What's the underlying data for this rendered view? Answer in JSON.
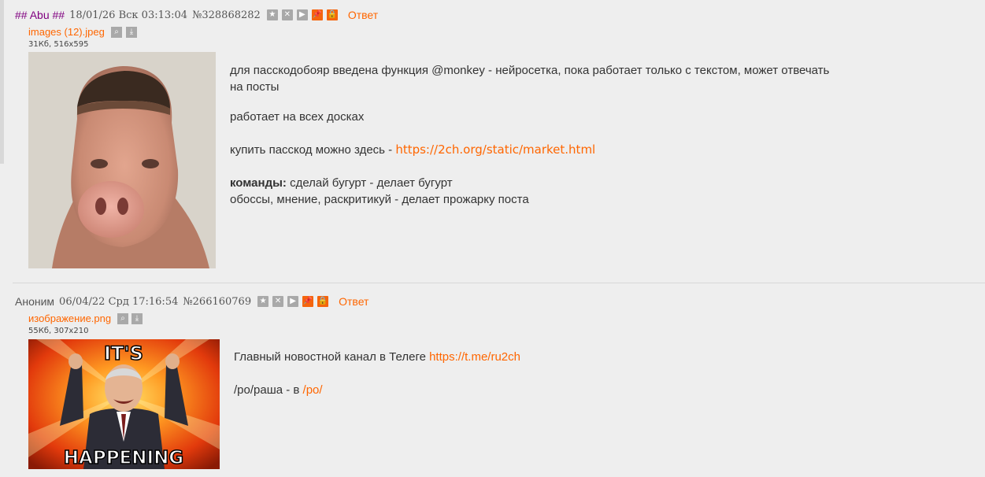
{
  "post1": {
    "name": "## Abu ##",
    "date": "18/01/26 Вск 03:13:04",
    "number": "№328868282",
    "reply": "Ответ",
    "file": {
      "name": "images (12).jpeg",
      "info": "31Кб, 516x595"
    },
    "message": {
      "line1": "для пасскодобояр введена функция @monkey - нейросетка, пока работает только с текстом, может отвечать",
      "line1b": "на посты",
      "line2": "работает на всех досках",
      "line3_text": "купить пасскод можно здесь - ",
      "line3_link": "https://2ch.org/static/market.html",
      "line4_bold": "команды:",
      "line4_text": " сделай бугурт - делает бугурт",
      "line5": "обоссы, мнение, раскритикуй - делает прожарку поста"
    }
  },
  "post2": {
    "name": "Аноним",
    "date": "06/04/22 Срд 17:16:54",
    "number": "№266160769",
    "reply": "Ответ",
    "file": {
      "name": "изображение.png",
      "info": "55Кб, 307x210"
    },
    "image_caption": {
      "top": "IT'S",
      "bottom": "HAPPENING"
    },
    "message": {
      "line1_text": "Главный новостной канал в Телеге ",
      "line1_link": "https://t.me/ru2ch",
      "line2_text": "/ро/раша - в ",
      "line2_link": "/po/"
    }
  },
  "icons": [
    "star-icon",
    "hide-icon",
    "play-icon",
    "pin-icon",
    "lock-icon",
    "search-icon",
    "download-icon"
  ],
  "colors": {
    "link": "#ff6600",
    "abu_name": "#800080",
    "background": "#eeeeee",
    "button": "#a9a9a9",
    "button_orange": "#f5650d"
  }
}
